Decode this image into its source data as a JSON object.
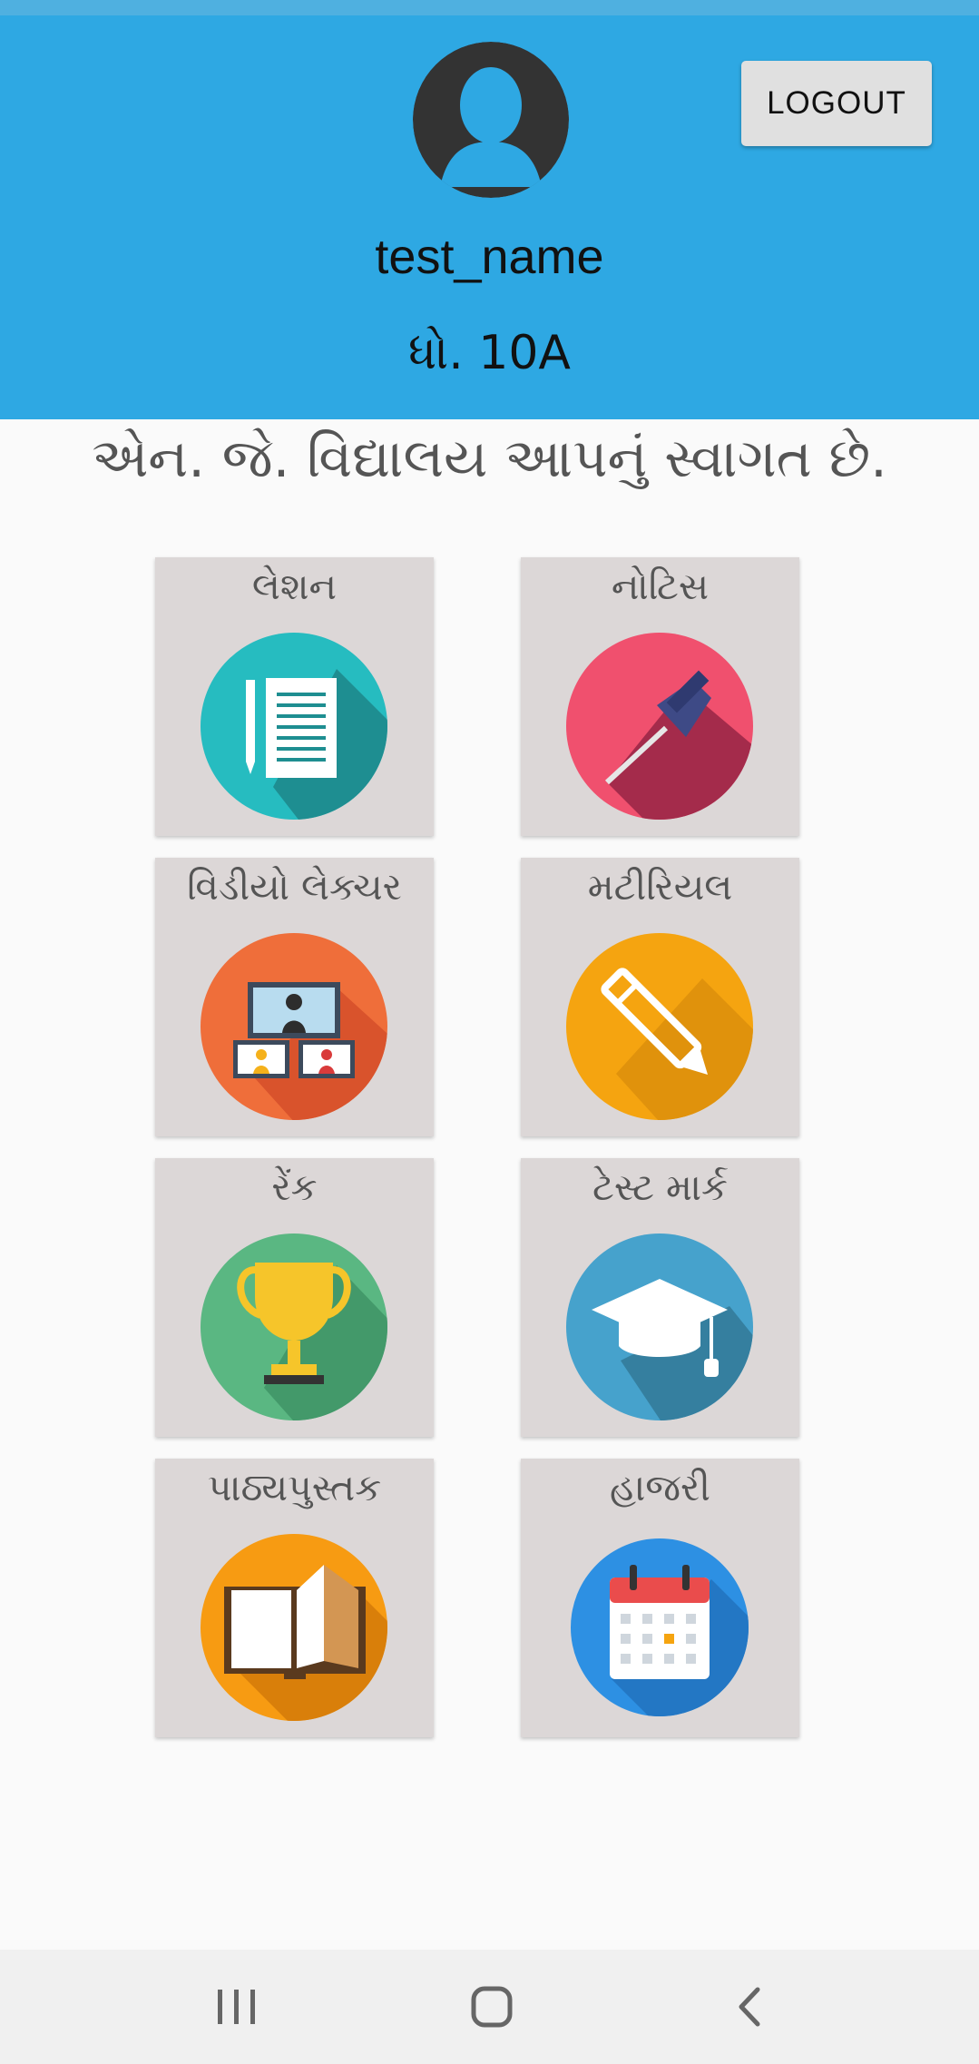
{
  "header": {
    "username": "test_name",
    "class_label": "ધો. 10A",
    "logout_label": "LOGOUT",
    "background_color": "#2ea8e3"
  },
  "welcome_text": "એન. જે. વિદ્યાલય આપનું સ્વાગત છે.",
  "tiles": [
    {
      "label": "લેશન",
      "icon": "notebook-icon"
    },
    {
      "label": "નોટિસ",
      "icon": "pushpin-icon"
    },
    {
      "label": "વિડીયો લેક્ચર",
      "icon": "video-lecture-icon"
    },
    {
      "label": "મટીરિયલ",
      "icon": "pencil-icon"
    },
    {
      "label": "રેંક",
      "icon": "trophy-icon"
    },
    {
      "label": "ટેસ્ટ માર્ક",
      "icon": "graduation-cap-icon"
    },
    {
      "label": "પાઠ્યપુસ્તક",
      "icon": "book-icon"
    },
    {
      "label": "હાજરી",
      "icon": "calendar-icon"
    }
  ],
  "navbar": {
    "items": [
      "recent-apps-icon",
      "home-icon",
      "back-icon"
    ]
  }
}
